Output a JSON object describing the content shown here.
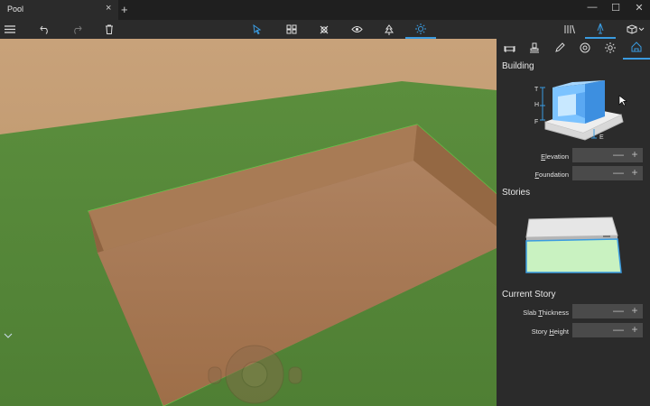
{
  "window": {
    "tab_title": "Pool",
    "tab_close": "×",
    "new_tab": "+",
    "minimize": "—",
    "maximize": "☐",
    "close": "✕"
  },
  "toolbar": {
    "left_icons": [
      "menu-icon",
      "undo-icon",
      "redo-icon",
      "delete-icon"
    ],
    "modes": [
      "select-icon",
      "components-icon",
      "materials-icon",
      "view-icon",
      "landscape-icon",
      "lighting-icon"
    ],
    "active_mode": "lighting-icon",
    "right_icons": [
      "catalog-icon",
      "building-icon",
      "3d-view-icon"
    ]
  },
  "panel": {
    "tabs": [
      "furniture-icon",
      "stamp-icon",
      "pencil-icon",
      "camera-icon",
      "sun-icon",
      "house-icon"
    ],
    "active_tab": "house-icon",
    "building": {
      "title": "Building",
      "diagram_labels": {
        "t": "T",
        "h": "H",
        "f_left": "F",
        "e": "E"
      },
      "fields": [
        {
          "label": "Elevation",
          "accel": "E",
          "rest": "levation"
        },
        {
          "label": "Foundation",
          "accel": "F",
          "rest": "oundation"
        }
      ]
    },
    "stories": {
      "title": "Stories"
    },
    "current_story": {
      "title": "Current Story",
      "fields": [
        {
          "label": "Slab Thickness",
          "pre": "Slab ",
          "accel": "T",
          "rest": "hickness"
        },
        {
          "label": "Story Height",
          "pre": "Story ",
          "accel": "H",
          "rest": "eight"
        }
      ]
    },
    "spinner": {
      "minus": "—",
      "plus": "+"
    }
  },
  "colors": {
    "accent": "#3a9be0",
    "sand": "#c29a6f",
    "grass": "#5a8a3c",
    "dirt": "#a67a52",
    "panel_bg": "#2b2b2b"
  }
}
